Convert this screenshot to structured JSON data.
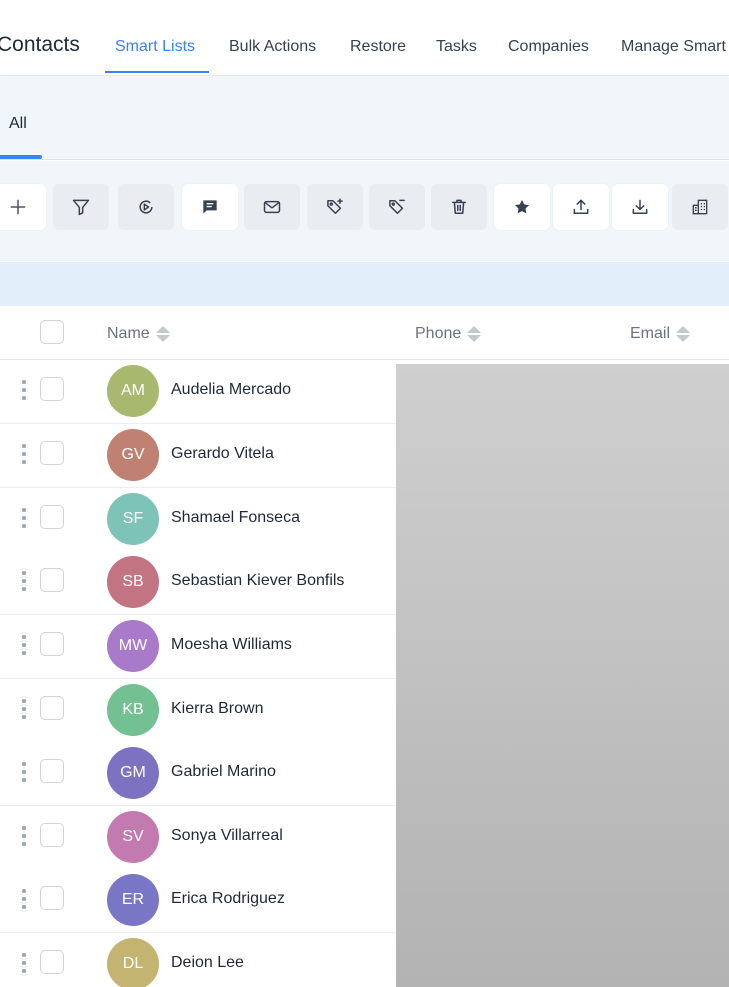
{
  "header": {
    "app_title": "Contacts",
    "tabs": [
      {
        "label": "Smart Lists",
        "active": true
      },
      {
        "label": "Bulk Actions",
        "active": false
      },
      {
        "label": "Restore",
        "active": false
      },
      {
        "label": "Tasks",
        "active": false
      },
      {
        "label": "Companies",
        "active": false
      },
      {
        "label": "Manage Smart Lists",
        "active": false
      }
    ]
  },
  "smart_list_tabs": [
    {
      "label": "All",
      "active": true
    }
  ],
  "toolbar": {
    "buttons": [
      {
        "name": "add-contact",
        "icon": "plus-icon"
      },
      {
        "name": "filter",
        "icon": "filter-icon"
      },
      {
        "name": "add-to-workflow",
        "icon": "play-circle-icon"
      },
      {
        "name": "send-sms",
        "icon": "message-icon"
      },
      {
        "name": "send-email",
        "icon": "envelope-icon"
      },
      {
        "name": "add-tag",
        "icon": "tag-plus-icon"
      },
      {
        "name": "remove-tag",
        "icon": "tag-minus-icon"
      },
      {
        "name": "delete",
        "icon": "trash-icon"
      },
      {
        "name": "review-request",
        "icon": "star-icon"
      },
      {
        "name": "export",
        "icon": "upload-icon"
      },
      {
        "name": "import",
        "icon": "download-icon"
      },
      {
        "name": "companies",
        "icon": "building-icon"
      }
    ]
  },
  "table": {
    "columns": {
      "name": "Name",
      "phone": "Phone",
      "email": "Email"
    },
    "rows": [
      {
        "initials": "AM",
        "name": "Audelia Mercado",
        "color": "#a8b96f"
      },
      {
        "initials": "GV",
        "name": "Gerardo Vitela",
        "color": "#c08172"
      },
      {
        "initials": "SF",
        "name": "Shamael Fonseca",
        "color": "#7ec3b8"
      },
      {
        "initials": "SB",
        "name": "Sebastian Kiever Bonfils",
        "color": "#c27483"
      },
      {
        "initials": "MW",
        "name": "Moesha Williams",
        "color": "#a97ac9"
      },
      {
        "initials": "KB",
        "name": "Kierra Brown",
        "color": "#73c192"
      },
      {
        "initials": "GM",
        "name": "Gabriel Marino",
        "color": "#7c72c1"
      },
      {
        "initials": "SV",
        "name": "Sonya Villarreal",
        "color": "#c37ab0"
      },
      {
        "initials": "ER",
        "name": "Erica Rodriguez",
        "color": "#7976c6"
      },
      {
        "initials": "DL",
        "name": "Deion Lee",
        "color": "#c3b571"
      }
    ]
  },
  "colors": {
    "accent": "#3b82f6",
    "toolbar_bg": "#f1f6fb",
    "info_strip": "#e3eefb"
  }
}
